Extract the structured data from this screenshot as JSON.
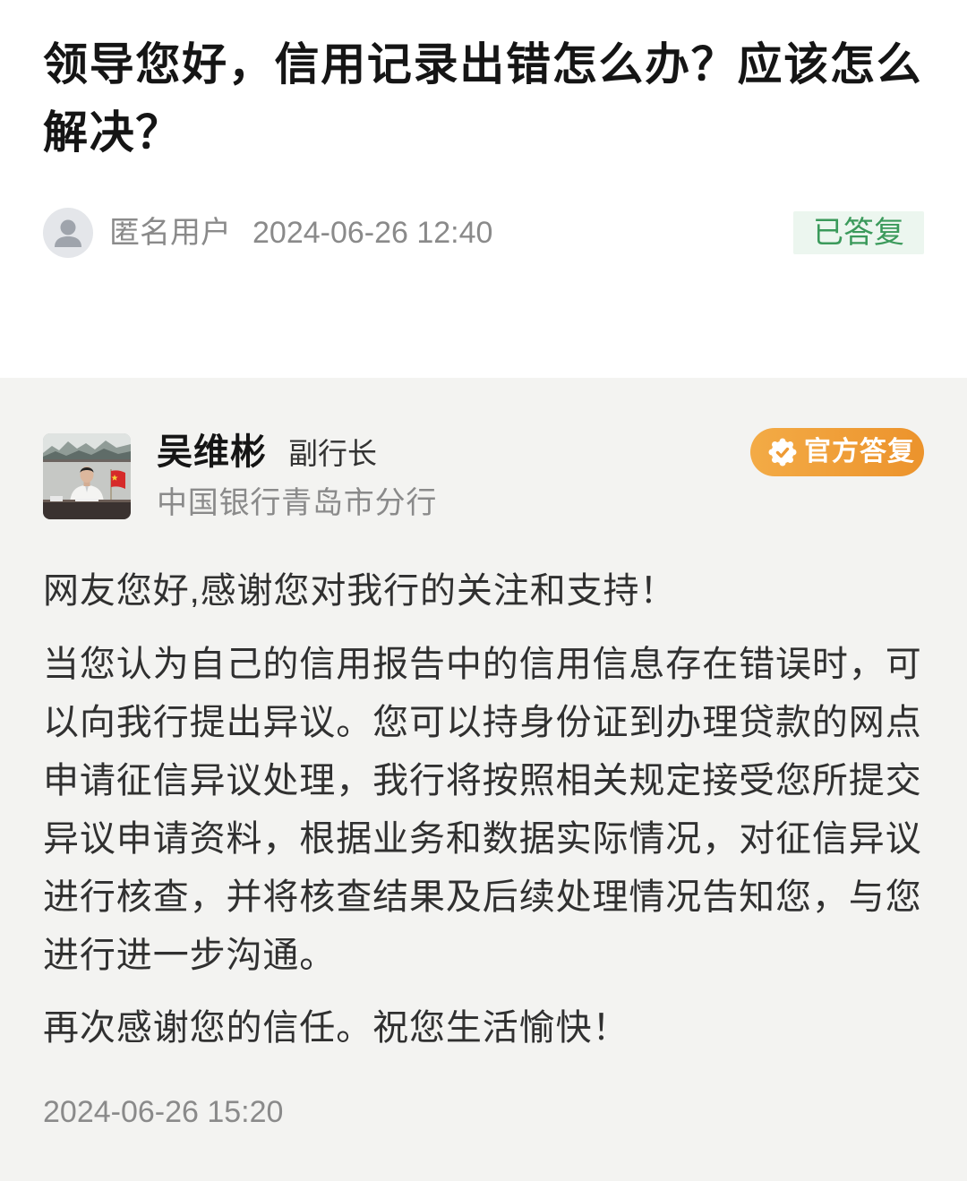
{
  "question": {
    "title": "领导您好，信用记录出错怎么办？应该怎么解决？",
    "asker_name": "匿名用户",
    "asker_avatar_icon": "user-icon",
    "posted_at": "2024-06-26 12:40",
    "status": "已答复"
  },
  "answer": {
    "responder_name": "吴维彬",
    "responder_position": "副行长",
    "responder_organization": "中国银行青岛市分行",
    "official_badge_label": "官方答复",
    "official_badge_icon": "verified-check-icon",
    "greeting": "网友您好,感谢您对我行的关注和支持！",
    "body": "当您认为自己的信用报告中的信用信息存在错误时，可以向我行提出异议。您可以持身份证到办理贷款的网点申请征信异议处理，我行将按照相关规定接受您所提交异议申请资料，根据业务和数据实际情况，对征信异议进行核查，并将核查结果及后续处理情况告知您，与您进行进一步沟通。",
    "closing": "再次感谢您的信任。祝您生活愉快！",
    "answered_at": "2024-06-26 15:20"
  },
  "colors": {
    "title_text": "#151515",
    "body_text": "#303030",
    "muted_text": "#8a8a8a",
    "status_green": "#3b9a5b",
    "status_green_bg": "#ecf6ef",
    "official_orange": "#ec932c",
    "answer_bg": "#f3f3f1",
    "page_bg": "#ffffff"
  }
}
